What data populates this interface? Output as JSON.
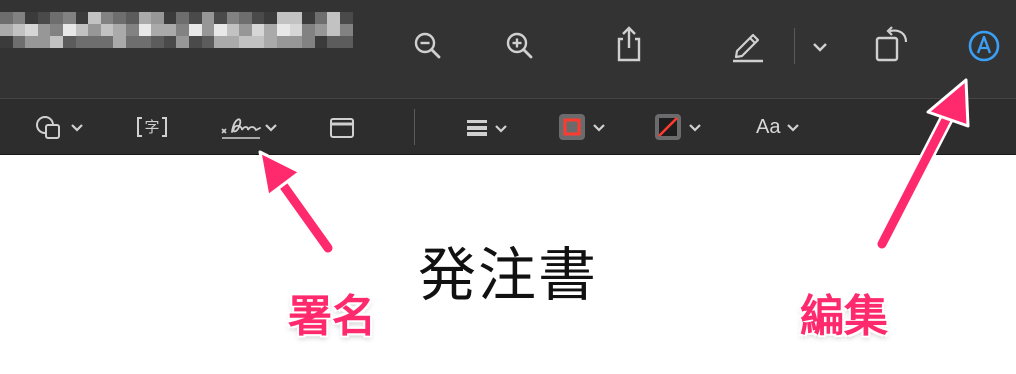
{
  "window": {
    "title_redacted": true
  },
  "toolbar_top": {
    "buttons": [
      {
        "name": "zoom-out"
      },
      {
        "name": "zoom-in"
      },
      {
        "name": "share"
      },
      {
        "name": "highlight"
      },
      {
        "name": "highlight-options"
      },
      {
        "name": "rotate"
      },
      {
        "name": "markup"
      }
    ],
    "markup_active_color": "#3a9ff5"
  },
  "toolbar_markup": {
    "text_box_glyph": "字",
    "font_button_label": "Aa",
    "border_color": "#ff3b30",
    "fill_color": "none"
  },
  "document": {
    "title": "発注書"
  },
  "annotations": {
    "signature_label": "署名",
    "edit_label": "編集",
    "color": "#ff2a6d"
  }
}
